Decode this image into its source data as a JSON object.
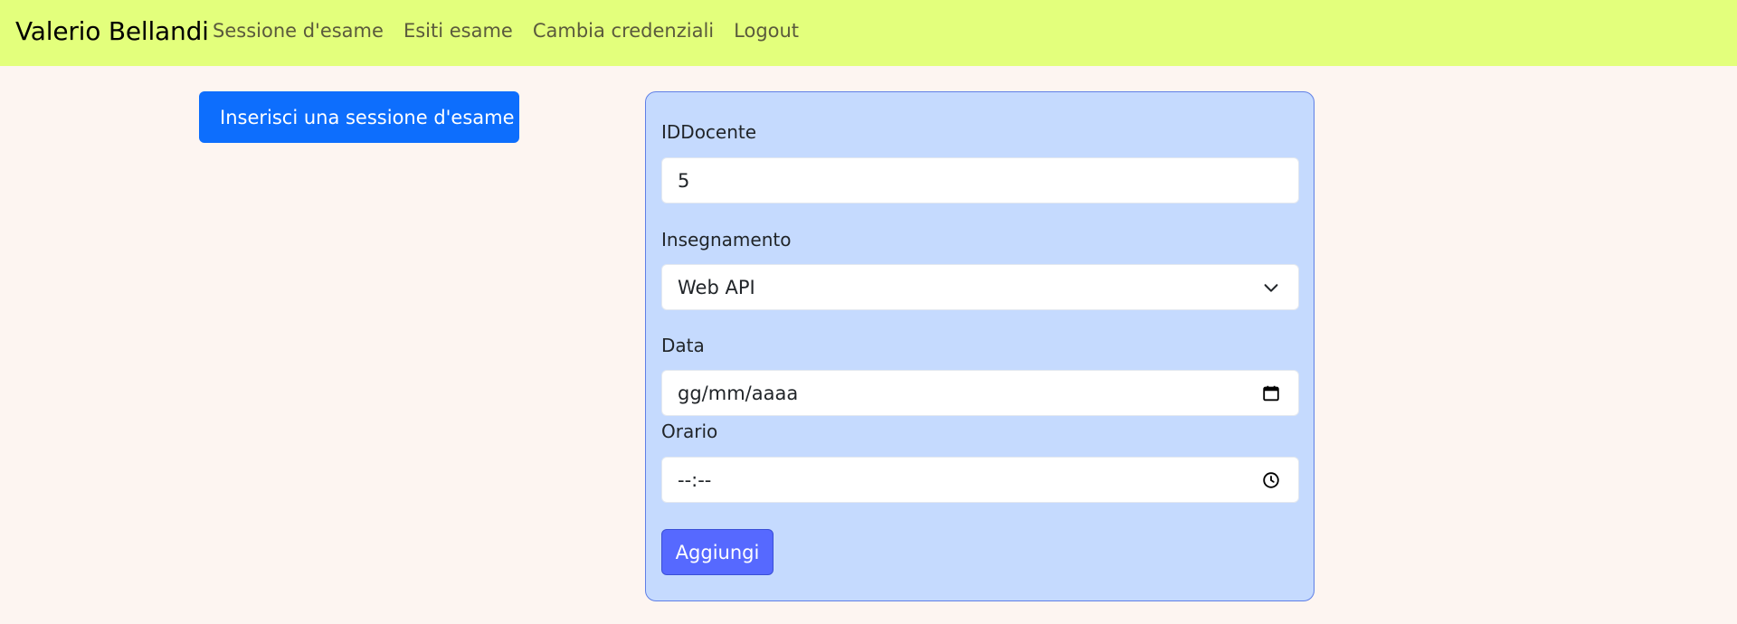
{
  "navbar": {
    "brand": "Valerio Bellandi",
    "links": [
      "Sessione d'esame",
      "Esiti esame",
      "Cambia credenziali",
      "Logout"
    ],
    "background": "#e3ff7c"
  },
  "sidebar": {
    "insert_button": "Inserisci una sessione d'esame"
  },
  "form": {
    "docente_label": "IDDocente",
    "docente_value": "5",
    "insegnamento_label": "Insegnamento",
    "insegnamento_value": "Web API",
    "data_label": "Data",
    "data_placeholder": "gg/mm/aaaa",
    "orario_label": "Orario",
    "orario_placeholder": "--:--",
    "submit_label": "Aggiungi"
  },
  "icons": {
    "select": "chevron-down-icon",
    "date": "calendar-icon",
    "time": "clock-icon"
  },
  "colors": {
    "primary": "#0d6efd",
    "card": "#c5dafe",
    "submit": "#5669ff",
    "page": "#fdf5f1"
  }
}
